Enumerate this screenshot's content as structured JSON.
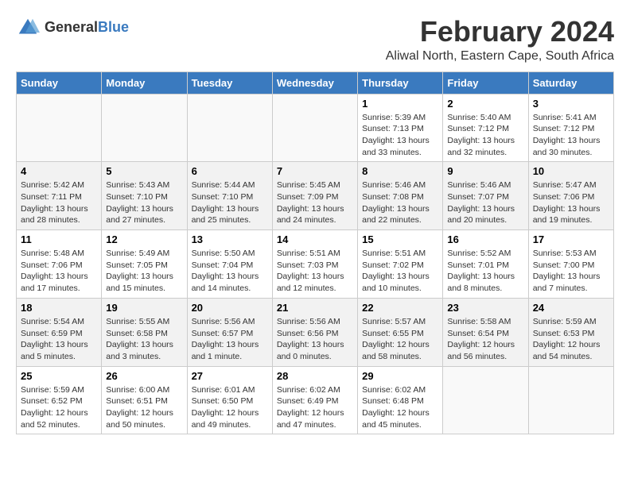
{
  "logo": {
    "general": "General",
    "blue": "Blue"
  },
  "header": {
    "month": "February 2024",
    "location": "Aliwal North, Eastern Cape, South Africa"
  },
  "weekdays": [
    "Sunday",
    "Monday",
    "Tuesday",
    "Wednesday",
    "Thursday",
    "Friday",
    "Saturday"
  ],
  "weeks": [
    [
      {
        "day": "",
        "info": ""
      },
      {
        "day": "",
        "info": ""
      },
      {
        "day": "",
        "info": ""
      },
      {
        "day": "",
        "info": ""
      },
      {
        "day": "1",
        "info": "Sunrise: 5:39 AM\nSunset: 7:13 PM\nDaylight: 13 hours\nand 33 minutes."
      },
      {
        "day": "2",
        "info": "Sunrise: 5:40 AM\nSunset: 7:12 PM\nDaylight: 13 hours\nand 32 minutes."
      },
      {
        "day": "3",
        "info": "Sunrise: 5:41 AM\nSunset: 7:12 PM\nDaylight: 13 hours\nand 30 minutes."
      }
    ],
    [
      {
        "day": "4",
        "info": "Sunrise: 5:42 AM\nSunset: 7:11 PM\nDaylight: 13 hours\nand 28 minutes."
      },
      {
        "day": "5",
        "info": "Sunrise: 5:43 AM\nSunset: 7:10 PM\nDaylight: 13 hours\nand 27 minutes."
      },
      {
        "day": "6",
        "info": "Sunrise: 5:44 AM\nSunset: 7:10 PM\nDaylight: 13 hours\nand 25 minutes."
      },
      {
        "day": "7",
        "info": "Sunrise: 5:45 AM\nSunset: 7:09 PM\nDaylight: 13 hours\nand 24 minutes."
      },
      {
        "day": "8",
        "info": "Sunrise: 5:46 AM\nSunset: 7:08 PM\nDaylight: 13 hours\nand 22 minutes."
      },
      {
        "day": "9",
        "info": "Sunrise: 5:46 AM\nSunset: 7:07 PM\nDaylight: 13 hours\nand 20 minutes."
      },
      {
        "day": "10",
        "info": "Sunrise: 5:47 AM\nSunset: 7:06 PM\nDaylight: 13 hours\nand 19 minutes."
      }
    ],
    [
      {
        "day": "11",
        "info": "Sunrise: 5:48 AM\nSunset: 7:06 PM\nDaylight: 13 hours\nand 17 minutes."
      },
      {
        "day": "12",
        "info": "Sunrise: 5:49 AM\nSunset: 7:05 PM\nDaylight: 13 hours\nand 15 minutes."
      },
      {
        "day": "13",
        "info": "Sunrise: 5:50 AM\nSunset: 7:04 PM\nDaylight: 13 hours\nand 14 minutes."
      },
      {
        "day": "14",
        "info": "Sunrise: 5:51 AM\nSunset: 7:03 PM\nDaylight: 13 hours\nand 12 minutes."
      },
      {
        "day": "15",
        "info": "Sunrise: 5:51 AM\nSunset: 7:02 PM\nDaylight: 13 hours\nand 10 minutes."
      },
      {
        "day": "16",
        "info": "Sunrise: 5:52 AM\nSunset: 7:01 PM\nDaylight: 13 hours\nand 8 minutes."
      },
      {
        "day": "17",
        "info": "Sunrise: 5:53 AM\nSunset: 7:00 PM\nDaylight: 13 hours\nand 7 minutes."
      }
    ],
    [
      {
        "day": "18",
        "info": "Sunrise: 5:54 AM\nSunset: 6:59 PM\nDaylight: 13 hours\nand 5 minutes."
      },
      {
        "day": "19",
        "info": "Sunrise: 5:55 AM\nSunset: 6:58 PM\nDaylight: 13 hours\nand 3 minutes."
      },
      {
        "day": "20",
        "info": "Sunrise: 5:56 AM\nSunset: 6:57 PM\nDaylight: 13 hours\nand 1 minute."
      },
      {
        "day": "21",
        "info": "Sunrise: 5:56 AM\nSunset: 6:56 PM\nDaylight: 13 hours\nand 0 minutes."
      },
      {
        "day": "22",
        "info": "Sunrise: 5:57 AM\nSunset: 6:55 PM\nDaylight: 12 hours\nand 58 minutes."
      },
      {
        "day": "23",
        "info": "Sunrise: 5:58 AM\nSunset: 6:54 PM\nDaylight: 12 hours\nand 56 minutes."
      },
      {
        "day": "24",
        "info": "Sunrise: 5:59 AM\nSunset: 6:53 PM\nDaylight: 12 hours\nand 54 minutes."
      }
    ],
    [
      {
        "day": "25",
        "info": "Sunrise: 5:59 AM\nSunset: 6:52 PM\nDaylight: 12 hours\nand 52 minutes."
      },
      {
        "day": "26",
        "info": "Sunrise: 6:00 AM\nSunset: 6:51 PM\nDaylight: 12 hours\nand 50 minutes."
      },
      {
        "day": "27",
        "info": "Sunrise: 6:01 AM\nSunset: 6:50 PM\nDaylight: 12 hours\nand 49 minutes."
      },
      {
        "day": "28",
        "info": "Sunrise: 6:02 AM\nSunset: 6:49 PM\nDaylight: 12 hours\nand 47 minutes."
      },
      {
        "day": "29",
        "info": "Sunrise: 6:02 AM\nSunset: 6:48 PM\nDaylight: 12 hours\nand 45 minutes."
      },
      {
        "day": "",
        "info": ""
      },
      {
        "day": "",
        "info": ""
      }
    ]
  ]
}
